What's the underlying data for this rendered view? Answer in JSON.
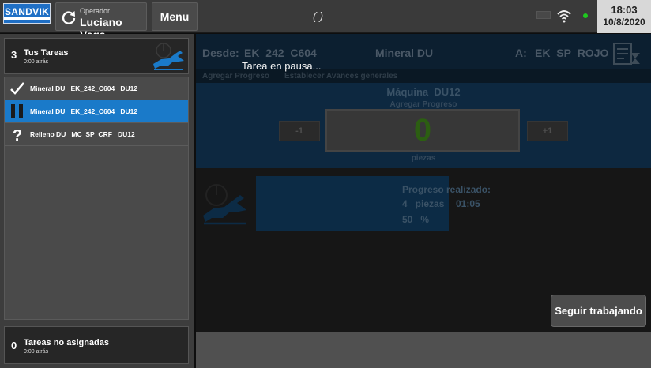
{
  "header": {
    "logo_text": "SANDVIK",
    "operator_label": "Operador",
    "operator_name": "Luciano Vega",
    "menu_label": "Menu",
    "center_status": "( )",
    "time": "18:03",
    "date": "10/8/2020",
    "status_color": "#1ec91e"
  },
  "sidebar": {
    "my_tasks": {
      "count": "3",
      "title": "Tus Tareas",
      "subtitle": "0:00 atrás"
    },
    "tasks": [
      {
        "label": "Mineral DU   EK_242_C604   DU12",
        "icon": "check-icon",
        "active": false
      },
      {
        "label": "Mineral DU   EK_242_C604   DU12",
        "icon": "pause-icon",
        "active": true
      },
      {
        "label": "Relleno DU   MC_SP_CRF   DU12",
        "icon": "question-icon",
        "active": false
      }
    ],
    "unassigned": {
      "count": "0",
      "title": "Tareas no asignadas",
      "subtitle": "0:00 atrás"
    }
  },
  "main": {
    "from_label": "Desde:",
    "from_value": "EK_242_C604",
    "material": "Mineral DU",
    "to_label": "A:",
    "to_value": "EK_SP_ROJO",
    "tabs": [
      "Agregar Progreso",
      "Establecer Avances generales"
    ],
    "machine_label": "Máquina",
    "machine_value": "DU12",
    "add_progress_label": "Agregar Progreso",
    "minus_label": "-1",
    "plus_label": "+1",
    "counter_value": "0",
    "pieces_label": "piezas",
    "progress_title": "Progreso realizado:",
    "progress_pieces": "4   piezas",
    "progress_time": "01:05",
    "progress_percent": "50   %",
    "progress_fraction": 0.5
  },
  "overlay": {
    "pause_message": "Tarea en pausa...",
    "continue_label": "Seguir trabajando"
  },
  "colors": {
    "accent": "#1a7ac9",
    "brand": "#1f6fc5"
  }
}
